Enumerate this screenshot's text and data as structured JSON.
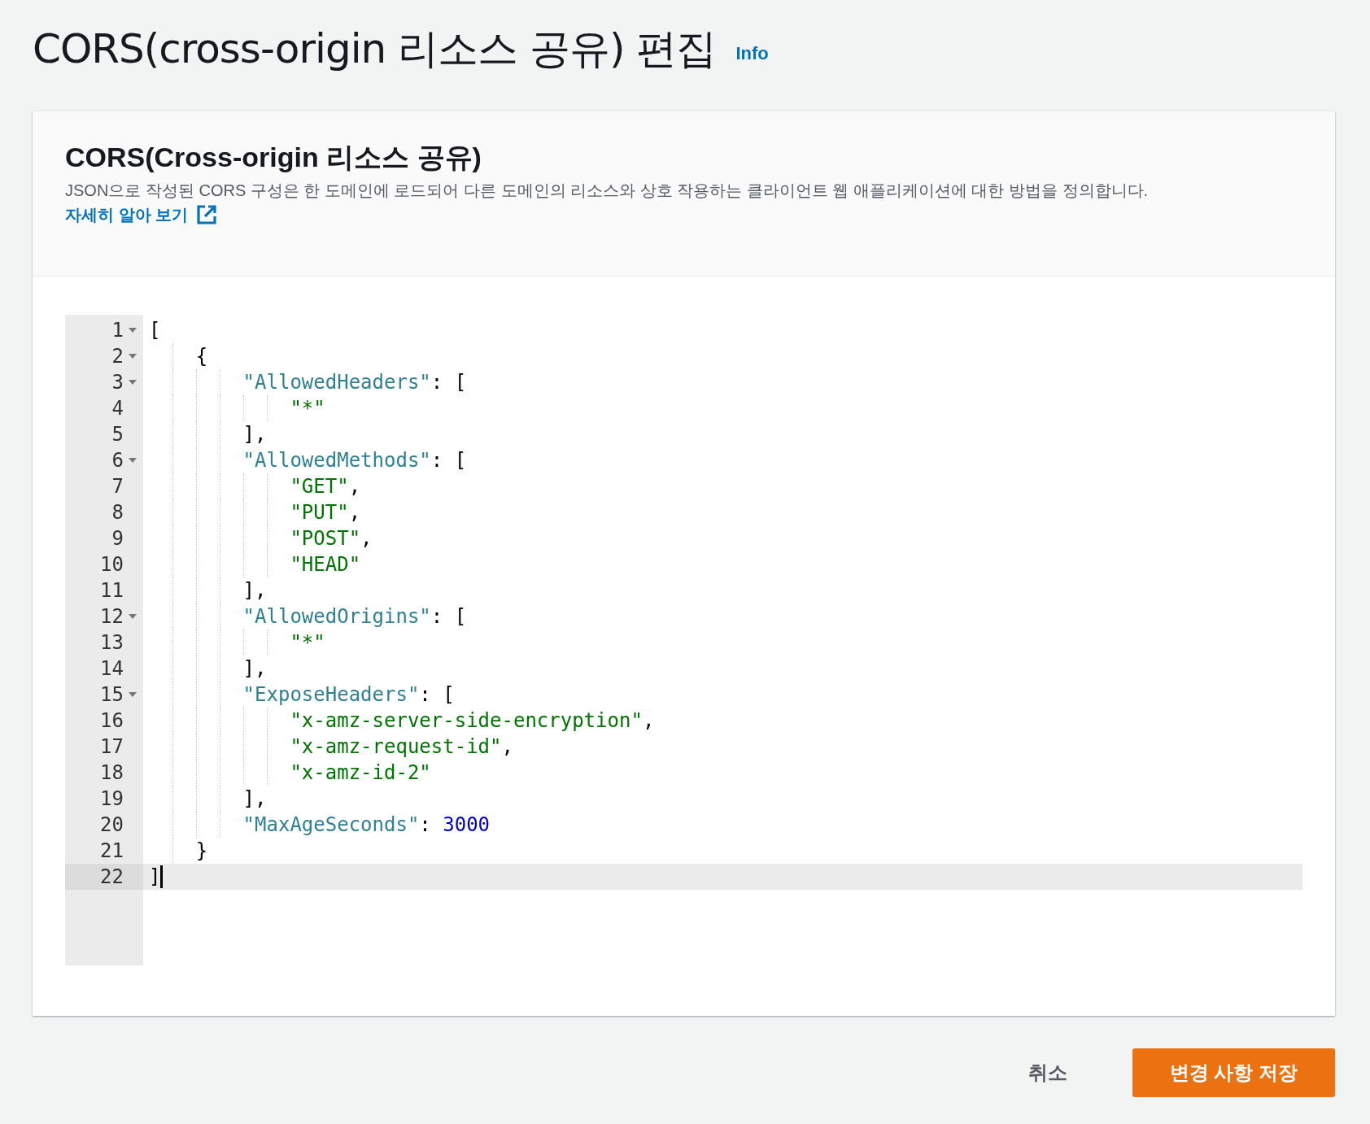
{
  "page": {
    "title": "CORS(cross-origin 리소스 공유) 편집",
    "info_link": "Info"
  },
  "panel": {
    "title": "CORS(Cross-origin 리소스 공유)",
    "description": "JSON으로 작성된 CORS 구성은 한 도메인에 로드되어 다른 도메인의 리소스와 상호 작용하는 클라이언트 웹 애플리케이션에 대한 방법을 정의합니다.",
    "learn_more_link": "자세히 알아 보기"
  },
  "editor": {
    "lines": [
      {
        "number": "1",
        "fold": true,
        "active": false,
        "tokens": [
          {
            "kind": "punct",
            "text": "["
          }
        ]
      },
      {
        "number": "2",
        "fold": true,
        "active": false,
        "tokens": [
          {
            "kind": "punct",
            "text": "{"
          }
        ]
      },
      {
        "number": "3",
        "fold": true,
        "active": false,
        "tokens": [
          {
            "kind": "key",
            "text": "\"AllowedHeaders\""
          },
          {
            "kind": "punct",
            "text": ": ["
          }
        ]
      },
      {
        "number": "4",
        "fold": false,
        "active": false,
        "tokens": [
          {
            "kind": "string",
            "text": "\"*\""
          }
        ]
      },
      {
        "number": "5",
        "fold": false,
        "active": false,
        "tokens": [
          {
            "kind": "close",
            "text": "],"
          }
        ]
      },
      {
        "number": "6",
        "fold": true,
        "active": false,
        "tokens": [
          {
            "kind": "key",
            "text": "\"AllowedMethods\""
          },
          {
            "kind": "punct",
            "text": ": ["
          }
        ]
      },
      {
        "number": "7",
        "fold": false,
        "active": false,
        "tokens": [
          {
            "kind": "string",
            "text": "\"GET\""
          },
          {
            "kind": "punct",
            "text": ","
          }
        ]
      },
      {
        "number": "8",
        "fold": false,
        "active": false,
        "tokens": [
          {
            "kind": "string",
            "text": "\"PUT\""
          },
          {
            "kind": "punct",
            "text": ","
          }
        ]
      },
      {
        "number": "9",
        "fold": false,
        "active": false,
        "tokens": [
          {
            "kind": "string",
            "text": "\"POST\""
          },
          {
            "kind": "punct",
            "text": ","
          }
        ]
      },
      {
        "number": "10",
        "fold": false,
        "active": false,
        "tokens": [
          {
            "kind": "string",
            "text": "\"HEAD\""
          }
        ]
      },
      {
        "number": "11",
        "fold": false,
        "active": false,
        "tokens": [
          {
            "kind": "close",
            "text": "],"
          }
        ]
      },
      {
        "number": "12",
        "fold": true,
        "active": false,
        "tokens": [
          {
            "kind": "key",
            "text": "\"AllowedOrigins\""
          },
          {
            "kind": "punct",
            "text": ": ["
          }
        ]
      },
      {
        "number": "13",
        "fold": false,
        "active": false,
        "tokens": [
          {
            "kind": "string",
            "text": "\"*\""
          }
        ]
      },
      {
        "number": "14",
        "fold": false,
        "active": false,
        "tokens": [
          {
            "kind": "close",
            "text": "],"
          }
        ]
      },
      {
        "number": "15",
        "fold": true,
        "active": false,
        "tokens": [
          {
            "kind": "key",
            "text": "\"ExposeHeaders\""
          },
          {
            "kind": "punct",
            "text": ": ["
          }
        ]
      },
      {
        "number": "16",
        "fold": false,
        "active": false,
        "tokens": [
          {
            "kind": "string",
            "text": "\"x-amz-server-side-encryption\""
          },
          {
            "kind": "punct",
            "text": ","
          }
        ]
      },
      {
        "number": "17",
        "fold": false,
        "active": false,
        "tokens": [
          {
            "kind": "string",
            "text": "\"x-amz-request-id\""
          },
          {
            "kind": "punct",
            "text": ","
          }
        ]
      },
      {
        "number": "18",
        "fold": false,
        "active": false,
        "tokens": [
          {
            "kind": "string",
            "text": "\"x-amz-id-2\""
          }
        ]
      },
      {
        "number": "19",
        "fold": false,
        "active": false,
        "tokens": [
          {
            "kind": "close",
            "text": "],"
          }
        ]
      },
      {
        "number": "20",
        "fold": false,
        "active": false,
        "tokens": [
          {
            "kind": "key",
            "text": "\"MaxAgeSeconds\""
          },
          {
            "kind": "punct",
            "text": ": "
          },
          {
            "kind": "number",
            "text": "3000"
          }
        ]
      },
      {
        "number": "21",
        "fold": false,
        "active": false,
        "tokens": [
          {
            "kind": "close",
            "text": "}"
          }
        ]
      },
      {
        "number": "22",
        "fold": false,
        "active": true,
        "tokens": [
          {
            "kind": "close",
            "text": "]"
          }
        ]
      }
    ]
  },
  "actions": {
    "cancel": "취소",
    "save": "변경 사항 저장"
  }
}
